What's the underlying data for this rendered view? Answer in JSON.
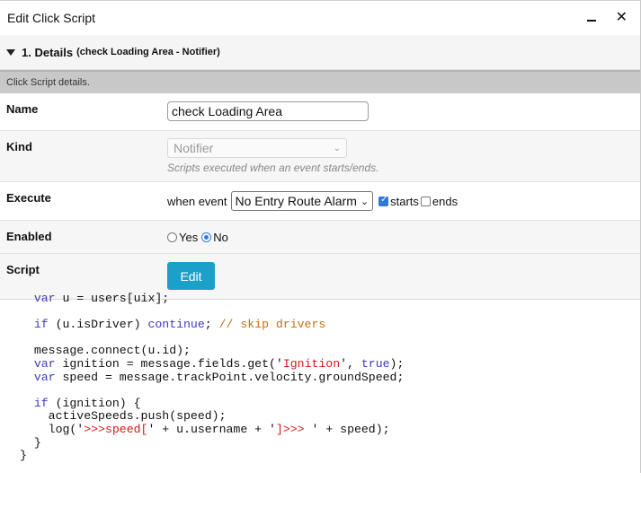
{
  "window": {
    "title": "Edit Click Script",
    "minimize_icon": "minimize-icon",
    "close_icon": "close-icon",
    "close_glyph": "✕"
  },
  "section": {
    "title": "1. Details",
    "subtitle": "(check Loading Area - Notifier)",
    "caret_icon": "caret-down-icon"
  },
  "info": "Click Script details.",
  "fields": {
    "name": {
      "label": "Name",
      "value": "check Loading Area"
    },
    "kind": {
      "label": "Kind",
      "selected": "Notifier",
      "hint": "Scripts executed when an event starts/ends."
    },
    "execute": {
      "label": "Execute",
      "when_label": "when event",
      "event_selected": "No Entry Route Alarm",
      "starts_label": "starts",
      "starts_checked": true,
      "ends_label": "ends",
      "ends_checked": false
    },
    "enabled": {
      "label": "Enabled",
      "yes_label": "Yes",
      "no_label": "No",
      "selected": "No"
    },
    "script": {
      "label": "Script",
      "edit_label": "Edit"
    }
  },
  "code_lines": [
    "  var u = users[uix];",
    "",
    "  if (u.isDriver) continue; // skip drivers",
    "",
    "  message.connect(u.id);",
    "  var ignition = message.fields.get('Ignition', true);",
    "  var speed = message.trackPoint.velocity.groundSpeed;",
    "",
    "  if (ignition) {",
    "    activeSpeeds.push(speed);",
    "    log('>>>speed[' + u.username + ']>>> ' + speed);",
    "  }",
    "}"
  ],
  "colors": {
    "accent": "#1aa0c9",
    "keyword": "#3c3ac4",
    "string": "#d11a1a",
    "comment": "#c8700f",
    "checkbox": "#2f79d9"
  }
}
